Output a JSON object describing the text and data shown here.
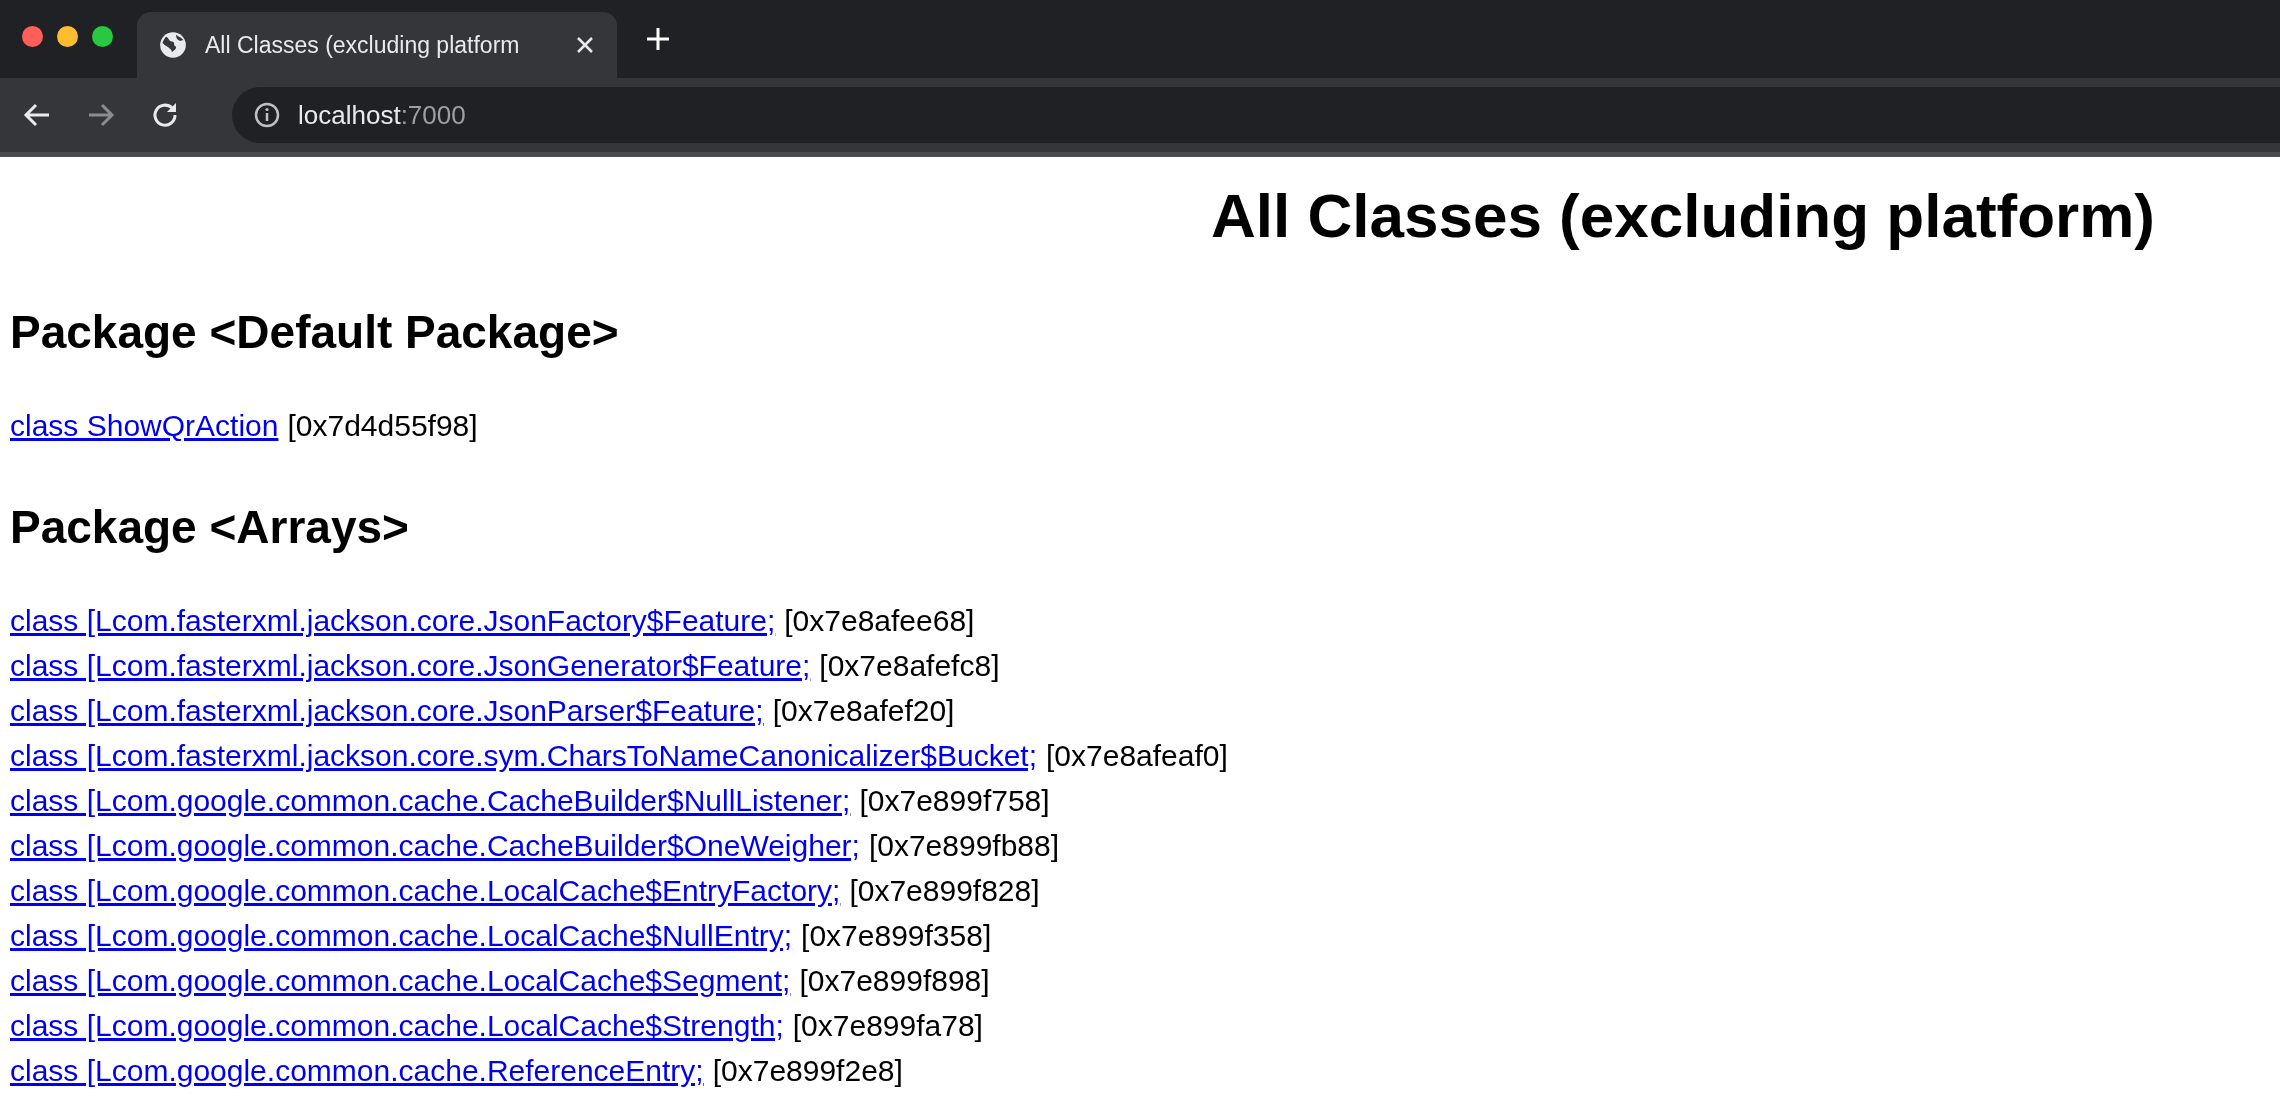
{
  "browser": {
    "tab": {
      "title": "All Classes (excluding platform",
      "selected": true
    },
    "address": {
      "host": "localhost",
      "port": ":7000"
    }
  },
  "page": {
    "title": "All Classes (excluding platform)",
    "packages": [
      {
        "heading": "Package <Default Package>",
        "classes": [
          {
            "name": "class ShowQrAction",
            "address": "[0x7d4d55f98]"
          }
        ]
      },
      {
        "heading": "Package <Arrays>",
        "classes": [
          {
            "name": "class [Lcom.fasterxml.jackson.core.JsonFactory$Feature;",
            "address": "[0x7e8afee68]"
          },
          {
            "name": "class [Lcom.fasterxml.jackson.core.JsonGenerator$Feature;",
            "address": "[0x7e8afefc8]"
          },
          {
            "name": "class [Lcom.fasterxml.jackson.core.JsonParser$Feature;",
            "address": "[0x7e8afef20]"
          },
          {
            "name": "class [Lcom.fasterxml.jackson.core.sym.CharsToNameCanonicalizer$Bucket;",
            "address": "[0x7e8afeaf0]"
          },
          {
            "name": "class [Lcom.google.common.cache.CacheBuilder$NullListener;",
            "address": "[0x7e899f758]"
          },
          {
            "name": "class [Lcom.google.common.cache.CacheBuilder$OneWeigher;",
            "address": "[0x7e899fb88]"
          },
          {
            "name": "class [Lcom.google.common.cache.LocalCache$EntryFactory;",
            "address": "[0x7e899f828]"
          },
          {
            "name": "class [Lcom.google.common.cache.LocalCache$NullEntry;",
            "address": "[0x7e899f358]"
          },
          {
            "name": "class [Lcom.google.common.cache.LocalCache$Segment;",
            "address": "[0x7e899f898]"
          },
          {
            "name": "class [Lcom.google.common.cache.LocalCache$Strength;",
            "address": "[0x7e899fa78]"
          },
          {
            "name": "class [Lcom.google.common.cache.ReferenceEntry;",
            "address": "[0x7e899f2e8]"
          }
        ]
      }
    ]
  }
}
